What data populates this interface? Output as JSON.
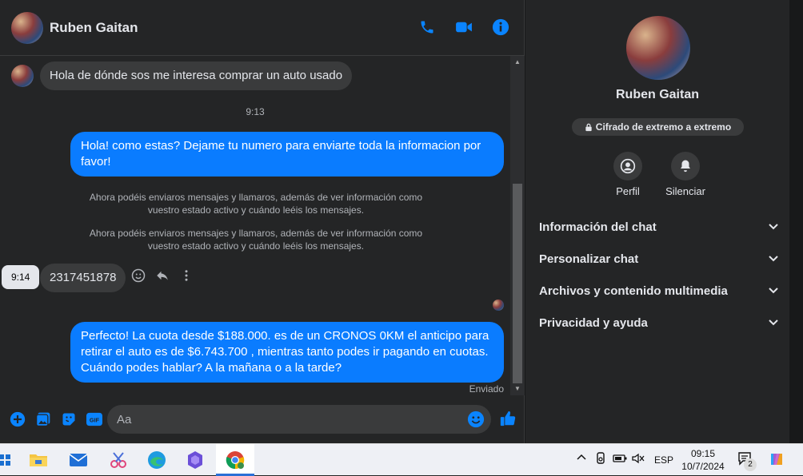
{
  "header": {
    "name": "Ruben Gaitan"
  },
  "messages": {
    "incoming_1": "Hola de dónde sos me interesa comprar un auto usado",
    "time_1": "9:13",
    "outgoing_1": "Hola! como estas? Dejame tu numero para enviarte toda la informacion por favor!",
    "system_1": "Ahora podéis enviaros mensajes y llamaros, además de ver información como vuestro estado activo y cuándo leéis los mensajes.",
    "system_2": "Ahora podéis enviaros mensajes y llamaros, además de ver información como vuestro estado activo y cuándo leéis los mensajes.",
    "tooltip_time": "9:14",
    "incoming_2": "2317451878",
    "outgoing_2": "Perfecto! La cuota desde $188.000. es de un CRONOS 0KM el anticipo para retirar el auto es de $6.743.700 , mientras tanto podes ir pagando en cuotas. Cuándo podes hablar? A la mañana o a la tarde?",
    "status": "Enviado"
  },
  "composer": {
    "placeholder": "Aa"
  },
  "side": {
    "name": "Ruben Gaitan",
    "encryption": "Cifrado de extremo a extremo",
    "profile_label": "Perfil",
    "mute_label": "Silenciar",
    "sections": [
      "Información del chat",
      "Personalizar chat",
      "Archivos y contenido multimedia",
      "Privacidad y ayuda"
    ]
  },
  "taskbar": {
    "language": "ESP",
    "time": "09:15",
    "date": "10/7/2024",
    "notification_count": "2"
  },
  "colors": {
    "accent": "#0a84ff",
    "outgoing_bubble": "#0a7cff",
    "background": "#242526"
  }
}
